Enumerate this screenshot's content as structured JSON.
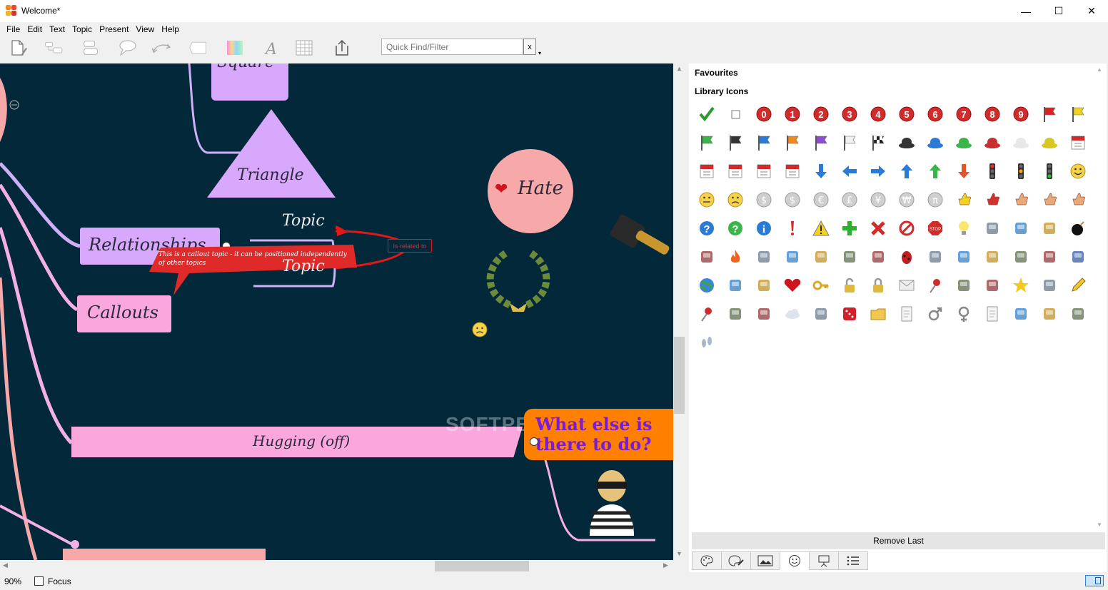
{
  "window": {
    "title": "Welcome*",
    "minimize": "—",
    "maximize": "☐",
    "close": "✕"
  },
  "menu": [
    "File",
    "Edit",
    "Text",
    "Topic",
    "Present",
    "View",
    "Help"
  ],
  "toolbar": {
    "buttons": [
      "new-document-icon",
      "add-subtopic-icon",
      "add-sibling-icon",
      "add-callout-icon",
      "relationship-icon",
      "boundary-icon",
      "color-gradient-icon",
      "font-icon",
      "table-icon",
      "export-icon"
    ],
    "search": {
      "placeholder": "Quick Find/Filter",
      "clear": "x",
      "dropdown": "▾"
    }
  },
  "canvas": {
    "topics": {
      "square": "Square",
      "triangle": "Triangle",
      "relationships": "Relationships",
      "callouts": "Callouts",
      "topic_plain": "Topic",
      "topic_callout": "Topic",
      "callout_text": "This is a callout topic - it can be positioned independently of other topics",
      "relation_label": "Is related to",
      "hate": "Hate",
      "hugging": "Hugging (off)",
      "what_else_line1": "What else is",
      "what_else_line2": "there to do?"
    },
    "watermark": "SOFTPEDIA",
    "colors": {
      "background": "#03283a",
      "purple_topic": "#d7a8fb",
      "pink_topic": "#f9a7dc",
      "callout_red": "#e02a2a",
      "hate_pink": "#f7a9a9",
      "orange": "#ff8000",
      "what_else_text": "#7a1bd8"
    }
  },
  "panel": {
    "favourites": "Favourites",
    "library_icons": "Library Icons",
    "remove_last": "Remove Last",
    "icons": [
      "tick-icon",
      "checkbox-icon",
      "priority-0-icon",
      "priority-1-icon",
      "priority-2-icon",
      "priority-3-icon",
      "priority-4-icon",
      "priority-5-icon",
      "priority-6-icon",
      "priority-7-icon",
      "priority-8-icon",
      "priority-9-icon",
      "flag-red-icon",
      "flag-yellow-icon",
      "flag-green-icon",
      "flag-black-icon",
      "flag-blue-icon",
      "flag-orange-icon",
      "flag-purple-icon",
      "flag-white-icon",
      "flag-checkered-icon",
      "hat-black-icon",
      "hat-blue-icon",
      "hat-green-icon",
      "hat-red-icon",
      "hat-white-icon",
      "hat-yellow-icon",
      "calendar-7-icon",
      "calendar-week-icon",
      "calendar-month-icon",
      "calendar-31-icon",
      "calendar-52-icon",
      "arrow-down-icon",
      "arrow-left-icon",
      "arrow-right-icon",
      "arrow-up-icon",
      "arrow-up-green-icon",
      "arrow-down-red-icon",
      "traffic-light-red-icon",
      "traffic-light-amber-icon",
      "traffic-light-green-icon",
      "smiley-happy-icon",
      "smiley-neutral-icon",
      "smiley-sad-icon",
      "money-icon",
      "dollar-icon",
      "euro-icon",
      "pound-icon",
      "yen-icon",
      "won-icon",
      "pi-icon",
      "thumb-yellow-icon",
      "thumb-red-icon",
      "hand-stop-icon",
      "thumb-down-icon",
      "thumb-up-icon",
      "question-blue-icon",
      "question-green-icon",
      "info-icon",
      "exclamation-icon",
      "warning-icon",
      "plus-icon",
      "cross-icon",
      "no-entry-icon",
      "stop-icon",
      "lightbulb-icon",
      "camera-icon",
      "broom-icon",
      "bell-icon",
      "bomb-icon",
      "dynamite-icon",
      "fire-icon",
      "bin-icon",
      "target-icon",
      "magnifier-icon",
      "plane-icon",
      "alarm-clock-icon",
      "bug-icon",
      "people-icon",
      "car-icon",
      "network-icon",
      "coffee-icon",
      "database-icon",
      "computer-icon",
      "globe-icon",
      "lightning-icon",
      "gear-icon",
      "heart-icon",
      "key-icon",
      "lock-open-icon",
      "lock-icon",
      "envelope-icon",
      "pin-icon",
      "printer-icon",
      "scales-icon",
      "star-icon",
      "telephone-icon",
      "pencil-icon",
      "pin-round-icon",
      "keyboard-icon",
      "stamp-icon",
      "cloud-icon",
      "compass-icon",
      "dice-icon",
      "folder-icon",
      "document-icon",
      "male-icon",
      "female-icon",
      "letter-icon",
      "paperclip-icon",
      "presentation-icon",
      "signpost-icon",
      "footprints-icon"
    ],
    "tabs": [
      "palette-icon",
      "palette-edit-icon",
      "image-icon",
      "smiley-tab-icon",
      "presentation-tab-icon",
      "list-icon"
    ]
  },
  "status": {
    "zoom": "90%",
    "focus": "Focus"
  }
}
